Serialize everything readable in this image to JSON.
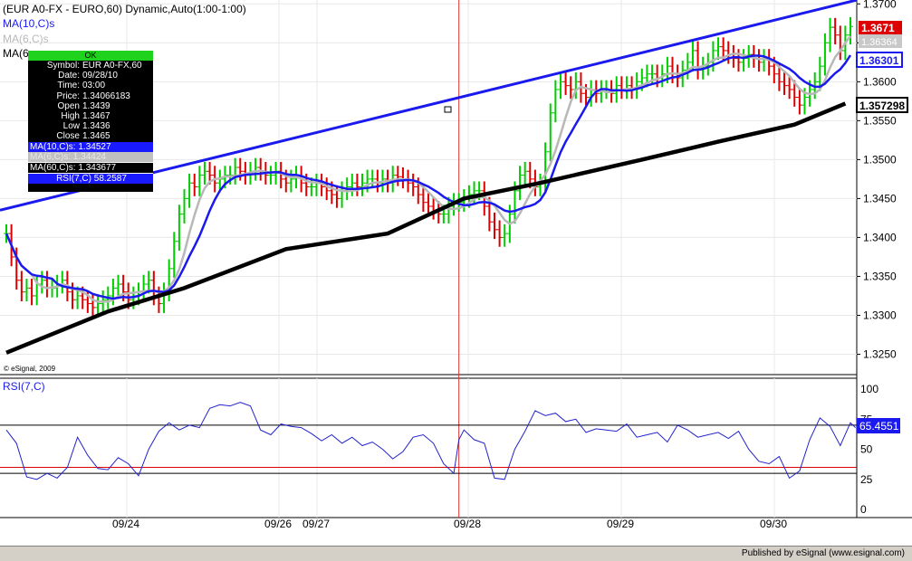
{
  "header": {
    "title": "(EUR A0-FX - EURO,60) Dynamic,Auto(1:00-1:00)",
    "ma10_label": "MA(10,C)s",
    "ma6_label": "MA(6,C)s",
    "ma60_label": "MA(6",
    "watermark": "© eSignal, 2009"
  },
  "price_axis": {
    "ticks": [
      "1.3700",
      "1.3650",
      "1.3600",
      "1.3550",
      "1.3500",
      "1.3450",
      "1.3400",
      "1.3350",
      "1.3300",
      "1.3250"
    ],
    "last_price": "1.3671",
    "ma6_value": "1.36364",
    "ma10_value": "1.36301",
    "ma60_value": "1.357298"
  },
  "rsi_panel": {
    "label": "RSI(7,C)",
    "ticks": [
      "100",
      "75",
      "50",
      "25",
      "0"
    ],
    "value": "65.4551"
  },
  "time_axis": {
    "labels": [
      "09/24",
      "09/26",
      "09/27",
      "09/28",
      "09/29",
      "09/30"
    ]
  },
  "data_window": {
    "ok": "OK",
    "rows": [
      {
        "label": "Symbol:",
        "value": "EUR A0-FX,60"
      },
      {
        "label": "Date:",
        "value": "09/28/10"
      },
      {
        "label": "Time:",
        "value": "03:00"
      },
      {
        "label": "Price:",
        "value": "1.34066183"
      },
      {
        "label": "Open",
        "value": "1.3439"
      },
      {
        "label": "High",
        "value": "1.3467"
      },
      {
        "label": "Low",
        "value": "1.3436"
      },
      {
        "label": "Close",
        "value": "1.3465"
      }
    ],
    "ma10": {
      "label": "MA(10,C)s",
      "value": "1.34527"
    },
    "ma6": {
      "label": "MA(6,C)s",
      "value": "1.34424"
    },
    "ma60": {
      "label": "MA(60,C)s",
      "value": "1.343677"
    },
    "rsi": {
      "label": "RSI(7,C)",
      "value": "58.2587"
    }
  },
  "footer": {
    "text": "Published by eSignal (www.esignal.com)"
  },
  "colors": {
    "up": "#00cc00",
    "down": "#dd0000",
    "ma10": "#1a1aee",
    "ma6": "#b8b8b8",
    "ma60": "#000000",
    "trend": "#1a1aee",
    "rsi": "#2222cc",
    "cursor": "#e03030"
  },
  "chart_data": {
    "type": "line",
    "title": "(EUR A0-FX - EURO,60) Dynamic,Auto(1:00-1:00)",
    "ylim": [
      1.3225,
      1.3705
    ],
    "rsi_ylim": [
      0,
      100
    ],
    "rsi_levels": [
      70,
      35,
      30
    ],
    "x_labels": [
      "09/24",
      "09/26",
      "09/27",
      "09/28",
      "09/29",
      "09/30"
    ],
    "trendline": {
      "start": 1.3435,
      "end": 1.3705
    },
    "cursor_bar": 89,
    "ma60_points": [
      [
        0,
        1.3252
      ],
      [
        20,
        1.3305
      ],
      [
        35,
        1.3335
      ],
      [
        55,
        1.3385
      ],
      [
        75,
        1.3405
      ],
      [
        90,
        1.345
      ],
      [
        105,
        1.347
      ],
      [
        125,
        1.35
      ],
      [
        140,
        1.3523
      ],
      [
        155,
        1.3545
      ],
      [
        165,
        1.3572
      ]
    ],
    "closes": [
      1.3405,
      1.3375,
      1.3345,
      1.333,
      1.3335,
      1.3325,
      1.334,
      1.3345,
      1.3335,
      1.3335,
      1.334,
      1.3345,
      1.333,
      1.332,
      1.3325,
      1.332,
      1.3315,
      1.331,
      1.3315,
      1.332,
      1.3325,
      1.3335,
      1.334,
      1.333,
      1.332,
      1.3325,
      1.333,
      1.334,
      1.3345,
      1.3325,
      1.3315,
      1.333,
      1.336,
      1.3395,
      1.343,
      1.345,
      1.347,
      1.3465,
      1.348,
      1.3485,
      1.348,
      1.347,
      1.3475,
      1.348,
      1.348,
      1.349,
      1.3485,
      1.348,
      1.3485,
      1.349,
      1.3485,
      1.348,
      1.348,
      1.3485,
      1.3475,
      1.347,
      1.3475,
      1.348,
      1.347,
      1.3465,
      1.3465,
      1.347,
      1.3465,
      1.346,
      1.3455,
      1.345,
      1.346,
      1.3465,
      1.347,
      1.3465,
      1.347,
      1.3475,
      1.3475,
      1.347,
      1.3475,
      1.347,
      1.348,
      1.3478,
      1.3475,
      1.347,
      1.3465,
      1.3455,
      1.3445,
      1.344,
      1.3435,
      1.343,
      1.343,
      1.344,
      1.3445,
      1.3445,
      1.345,
      1.3455,
      1.346,
      1.346,
      1.344,
      1.342,
      1.341,
      1.34,
      1.3405,
      1.343,
      1.346,
      1.348,
      1.3485,
      1.3475,
      1.3465,
      1.347,
      1.351,
      1.356,
      1.359,
      1.36,
      1.3595,
      1.359,
      1.36,
      1.3585,
      1.358,
      1.359,
      1.3585,
      1.359,
      1.359,
      1.3585,
      1.3595,
      1.359,
      1.3595,
      1.359,
      1.36,
      1.3605,
      1.361,
      1.361,
      1.3605,
      1.361,
      1.362,
      1.361,
      1.3605,
      1.3615,
      1.3625,
      1.364,
      1.3615,
      1.362,
      1.3625,
      1.364,
      1.3645,
      1.364,
      1.3635,
      1.363,
      1.3625,
      1.363,
      1.3635,
      1.363,
      1.3625,
      1.363,
      1.362,
      1.361,
      1.36,
      1.3595,
      1.359,
      1.358,
      1.357,
      1.358,
      1.359,
      1.36,
      1.362,
      1.365,
      1.367,
      1.366,
      1.364,
      1.366,
      1.3671
    ],
    "rsi_points": [
      [
        0,
        66
      ],
      [
        2,
        55
      ],
      [
        4,
        27
      ],
      [
        6,
        25
      ],
      [
        8,
        30
      ],
      [
        10,
        26
      ],
      [
        12,
        35
      ],
      [
        14,
        60
      ],
      [
        16,
        45
      ],
      [
        18,
        34
      ],
      [
        20,
        33
      ],
      [
        22,
        43
      ],
      [
        24,
        38
      ],
      [
        26,
        28
      ],
      [
        28,
        50
      ],
      [
        30,
        65
      ],
      [
        32,
        72
      ],
      [
        34,
        66
      ],
      [
        36,
        70
      ],
      [
        38,
        68
      ],
      [
        40,
        84
      ],
      [
        42,
        87
      ],
      [
        44,
        86
      ],
      [
        46,
        89
      ],
      [
        48,
        86
      ],
      [
        50,
        66
      ],
      [
        52,
        62
      ],
      [
        54,
        71
      ],
      [
        56,
        69
      ],
      [
        58,
        68
      ],
      [
        60,
        63
      ],
      [
        62,
        57
      ],
      [
        64,
        62
      ],
      [
        66,
        55
      ],
      [
        68,
        60
      ],
      [
        70,
        53
      ],
      [
        72,
        56
      ],
      [
        74,
        50
      ],
      [
        76,
        42
      ],
      [
        78,
        48
      ],
      [
        80,
        60
      ],
      [
        82,
        62
      ],
      [
        84,
        55
      ],
      [
        86,
        38
      ],
      [
        88,
        30
      ],
      [
        89,
        58
      ],
      [
        90,
        66
      ],
      [
        92,
        58
      ],
      [
        94,
        55
      ],
      [
        96,
        26
      ],
      [
        98,
        25
      ],
      [
        100,
        50
      ],
      [
        102,
        65
      ],
      [
        104,
        82
      ],
      [
        106,
        78
      ],
      [
        108,
        80
      ],
      [
        110,
        73
      ],
      [
        112,
        75
      ],
      [
        114,
        64
      ],
      [
        116,
        67
      ],
      [
        118,
        66
      ],
      [
        120,
        65
      ],
      [
        122,
        71
      ],
      [
        124,
        60
      ],
      [
        126,
        62
      ],
      [
        128,
        64
      ],
      [
        130,
        56
      ],
      [
        132,
        70
      ],
      [
        134,
        66
      ],
      [
        136,
        60
      ],
      [
        138,
        62
      ],
      [
        140,
        64
      ],
      [
        142,
        59
      ],
      [
        144,
        65
      ],
      [
        146,
        50
      ],
      [
        148,
        40
      ],
      [
        150,
        38
      ],
      [
        152,
        44
      ],
      [
        154,
        26
      ],
      [
        156,
        32
      ],
      [
        158,
        58
      ],
      [
        160,
        76
      ],
      [
        162,
        69
      ],
      [
        164,
        53
      ],
      [
        166,
        72
      ],
      [
        167,
        68
      ]
    ]
  }
}
